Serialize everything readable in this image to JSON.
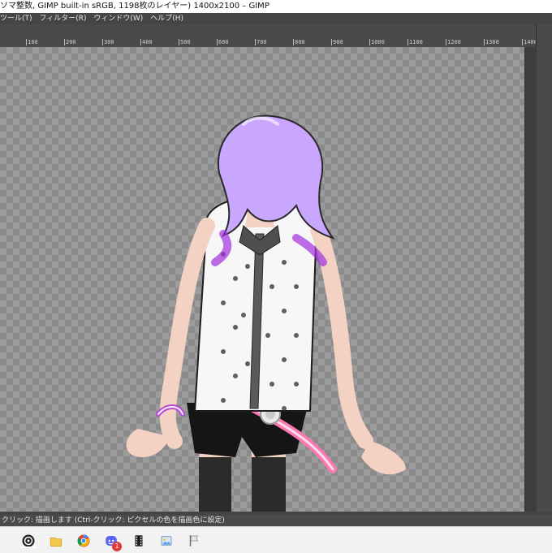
{
  "window": {
    "title": "ソマ整数, GIMP built-in sRGB, 1198枚のレイヤー) 1400x2100 – GIMP"
  },
  "menu": {
    "items": [
      {
        "label": "ツール(T)"
      },
      {
        "label": "フィルター(R)"
      },
      {
        "label": "ウィンドウ(W)"
      },
      {
        "label": "ヘルプ(H)"
      }
    ]
  },
  "ruler": {
    "ticks": [
      "100",
      "200",
      "300",
      "400",
      "500",
      "600",
      "700",
      "800",
      "900",
      "1000",
      "1100",
      "1200",
      "1300",
      "1400"
    ]
  },
  "status": {
    "text": "クリック: 描画します (Ctrl-クリック: ピクセルの色を描画色に設定)"
  },
  "taskbar": {
    "icons": [
      {
        "name": "obs-icon"
      },
      {
        "name": "folder-icon"
      },
      {
        "name": "chrome-icon"
      },
      {
        "name": "discord-icon"
      },
      {
        "name": "film-icon"
      },
      {
        "name": "image-icon"
      },
      {
        "name": "flag-icon"
      }
    ],
    "badge": "1"
  }
}
